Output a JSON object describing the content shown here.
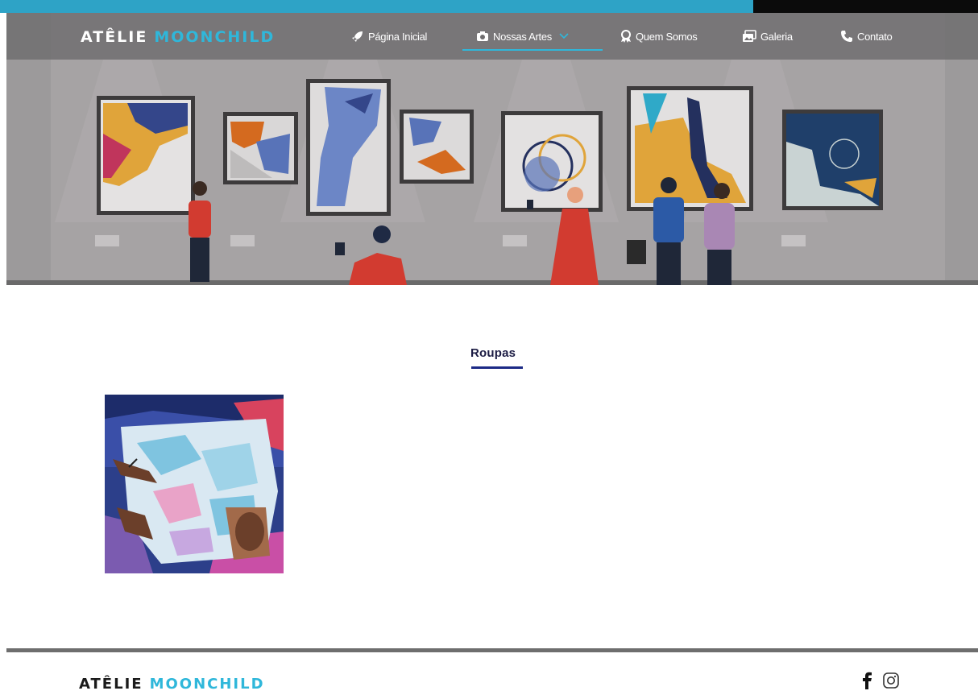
{
  "progress": {
    "fill_fraction": 0.77,
    "fill_color": "#2ea3c6",
    "track_color": "#0b0b0b"
  },
  "brand": {
    "part1": "ATÊLIE",
    "part2": "MOONCHILD",
    "accent_color": "#2fb7da"
  },
  "nav": {
    "items": [
      {
        "label": "Página Inicial",
        "icon": "rocket-icon"
      },
      {
        "label": "Nossas Artes",
        "icon": "camera-icon",
        "active": true,
        "has_dropdown": true
      },
      {
        "label": "Quem Somos",
        "icon": "award-icon"
      },
      {
        "label": "Galeria",
        "icon": "images-icon"
      },
      {
        "label": "Contato",
        "icon": "phone-icon"
      }
    ]
  },
  "hero": {
    "alt_subject": "art-gallery-illustration"
  },
  "section": {
    "title": "Roupas",
    "title_color": "#1c1c44",
    "underline_color": "#1c2a86"
  },
  "gallery": [
    {
      "subject": "person-in-tie-dye-shirt-photo"
    }
  ],
  "footer": {
    "brand_part1": "ATÊLIE",
    "brand_part2": "MOONCHILD",
    "social": [
      {
        "icon": "facebook-icon"
      },
      {
        "icon": "instagram-icon"
      }
    ]
  }
}
